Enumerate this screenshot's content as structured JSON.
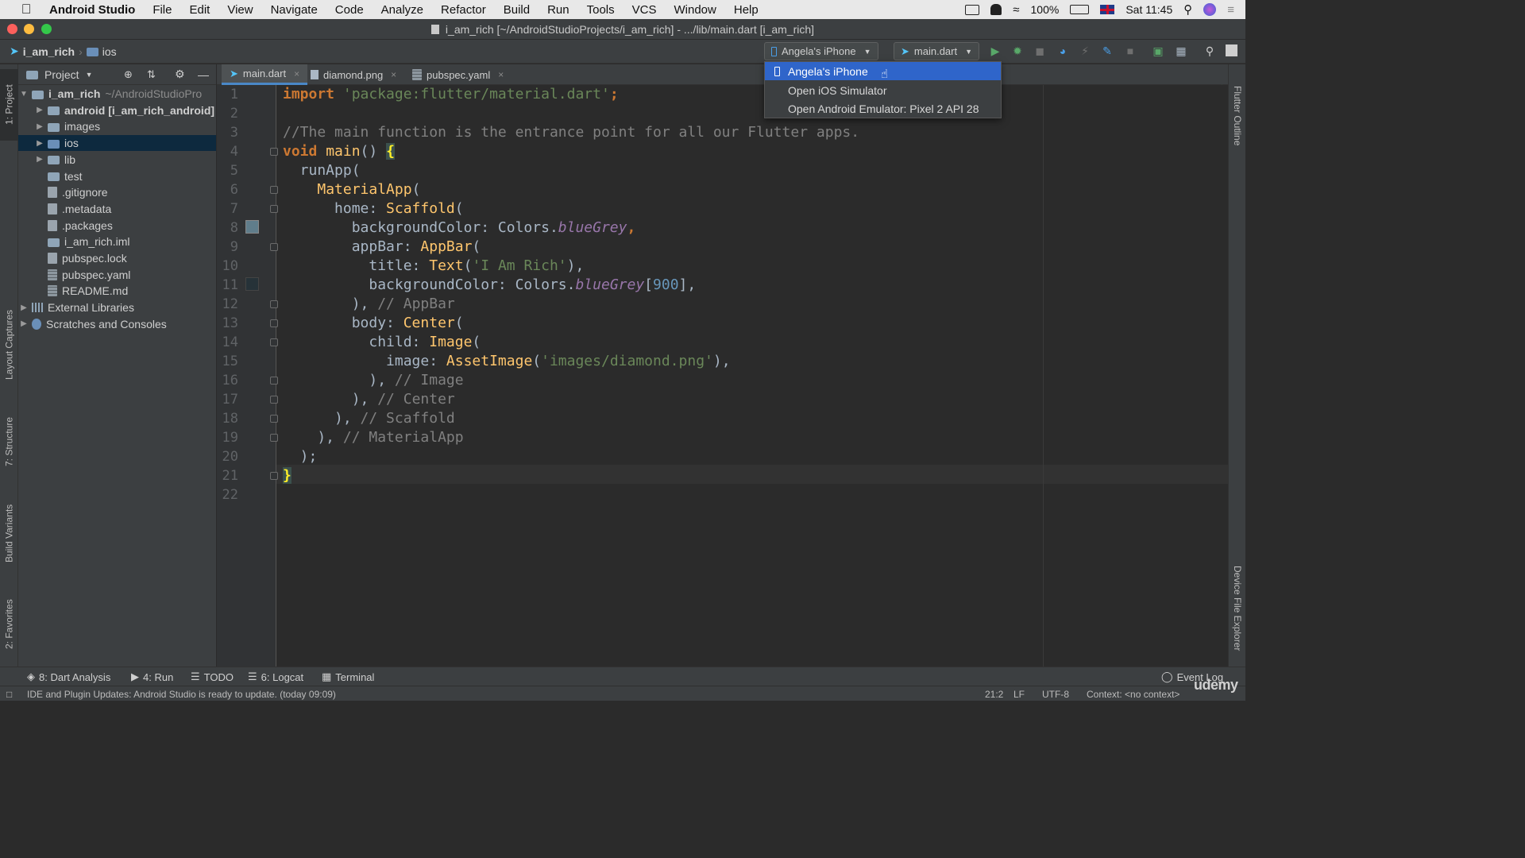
{
  "menubar": {
    "app_name": "Android Studio",
    "items": [
      "File",
      "Edit",
      "View",
      "Navigate",
      "Code",
      "Analyze",
      "Refactor",
      "Build",
      "Run",
      "Tools",
      "VCS",
      "Window",
      "Help"
    ],
    "battery": "100%",
    "clock": "Sat 11:45"
  },
  "window": {
    "title": "i_am_rich [~/AndroidStudioProjects/i_am_rich] - .../lib/main.dart [i_am_rich]"
  },
  "navbar": {
    "project": "i_am_rich",
    "folder": "ios",
    "device_selector": "Angela's iPhone",
    "run_config": "main.dart"
  },
  "device_menu": {
    "items": [
      "Angela's iPhone",
      "Open iOS Simulator",
      "Open Android Emulator: Pixel 2 API 28"
    ],
    "selected_index": 0
  },
  "project_panel": {
    "header": "Project",
    "tree": [
      {
        "label": "i_am_rich",
        "suffix": "~/AndroidStudioPro",
        "level": 0,
        "expanded": true,
        "kind": "folder"
      },
      {
        "label": "android [i_am_rich_android]",
        "level": 1,
        "kind": "folder"
      },
      {
        "label": "images",
        "level": 1,
        "kind": "folder"
      },
      {
        "label": "ios",
        "level": 1,
        "kind": "folder",
        "selected": true
      },
      {
        "label": "lib",
        "level": 1,
        "kind": "folder"
      },
      {
        "label": "test",
        "level": 1,
        "kind": "folder"
      },
      {
        "label": ".gitignore",
        "level": 1,
        "kind": "file"
      },
      {
        "label": ".metadata",
        "level": 1,
        "kind": "file"
      },
      {
        "label": ".packages",
        "level": 1,
        "kind": "file"
      },
      {
        "label": "i_am_rich.iml",
        "level": 1,
        "kind": "folder"
      },
      {
        "label": "pubspec.lock",
        "level": 1,
        "kind": "file"
      },
      {
        "label": "pubspec.yaml",
        "level": 1,
        "kind": "grid"
      },
      {
        "label": "README.md",
        "level": 1,
        "kind": "grid"
      },
      {
        "label": "External Libraries",
        "level": 0,
        "kind": "lib"
      },
      {
        "label": "Scratches and Consoles",
        "level": 0,
        "kind": "scratch"
      }
    ]
  },
  "tabs": [
    {
      "label": "main.dart",
      "active": true
    },
    {
      "label": "diamond.png",
      "active": false
    },
    {
      "label": "pubspec.yaml",
      "active": false
    }
  ],
  "left_strip": [
    "1: Project",
    "Layout Captures",
    "7: Structure",
    "Build Variants",
    "2: Favorites"
  ],
  "right_strip": [
    "Flutter Outline",
    "Device File Explorer"
  ],
  "editor": {
    "lines": [
      [
        [
          "kw",
          "import "
        ],
        [
          "str",
          "'package:flutter/material.dart'"
        ],
        [
          "kw",
          ";"
        ]
      ],
      [],
      [
        [
          "cmt",
          "//The main function is the entrance point for all our Flutter apps."
        ]
      ],
      [
        [
          "kw",
          "void "
        ],
        [
          "cls",
          "main"
        ],
        [
          "",
          "() "
        ],
        [
          "brk",
          "{"
        ]
      ],
      [
        [
          "",
          "  runApp("
        ]
      ],
      [
        [
          "",
          "    "
        ],
        [
          "cls",
          "MaterialApp"
        ],
        [
          "",
          "("
        ]
      ],
      [
        [
          "",
          "      home: "
        ],
        [
          "cls",
          "Scaffold"
        ],
        [
          "",
          "("
        ]
      ],
      [
        [
          "",
          "        backgroundColor: Colors."
        ],
        [
          "fld",
          "blueGrey"
        ],
        [
          "kw",
          ","
        ]
      ],
      [
        [
          "",
          "        appBar: "
        ],
        [
          "cls",
          "AppBar"
        ],
        [
          "",
          "("
        ]
      ],
      [
        [
          "",
          "          title: "
        ],
        [
          "cls",
          "Text"
        ],
        [
          "",
          "("
        ],
        [
          "str",
          "'I Am Rich'"
        ],
        [
          "",
          "),"
        ]
      ],
      [
        [
          "",
          "          backgroundColor: Colors."
        ],
        [
          "fld",
          "blueGrey"
        ],
        [
          "",
          "["
        ],
        [
          "num",
          "900"
        ],
        [
          "",
          "],"
        ]
      ],
      [
        [
          "",
          "        ), "
        ],
        [
          "cmt",
          "// AppBar"
        ]
      ],
      [
        [
          "",
          "        body: "
        ],
        [
          "cls",
          "Center"
        ],
        [
          "",
          "("
        ]
      ],
      [
        [
          "",
          "          child: "
        ],
        [
          "cls",
          "Image"
        ],
        [
          "",
          "("
        ]
      ],
      [
        [
          "",
          "            image: "
        ],
        [
          "cls",
          "AssetImage"
        ],
        [
          "",
          "("
        ],
        [
          "str",
          "'images/diamond.png'"
        ],
        [
          "",
          "),"
        ]
      ],
      [
        [
          "",
          "          ), "
        ],
        [
          "cmt",
          "// Image"
        ]
      ],
      [
        [
          "",
          "        ), "
        ],
        [
          "cmt",
          "// Center"
        ]
      ],
      [
        [
          "",
          "      ), "
        ],
        [
          "cmt",
          "// Scaffold"
        ]
      ],
      [
        [
          "",
          "    ), "
        ],
        [
          "cmt",
          "// MaterialApp"
        ]
      ],
      [
        [
          "",
          "  );"
        ]
      ],
      [
        [
          "brk",
          "}"
        ]
      ],
      []
    ]
  },
  "bottom_tabs": [
    "8: Dart Analysis",
    "4: Run",
    "TODO",
    "6: Logcat",
    "Terminal",
    "Event Log"
  ],
  "status": {
    "message": "IDE and Plugin Updates: Android Studio is ready to update. (today 09:09)",
    "position": "21:2",
    "line_sep": "LF",
    "encoding": "UTF-8",
    "context": "Context: <no context>"
  },
  "watermark": "udemy",
  "colors": {
    "accent": "#2f65ca",
    "swatch_bluegrey": "#607d8b",
    "swatch_bluegrey900": "#263238"
  }
}
